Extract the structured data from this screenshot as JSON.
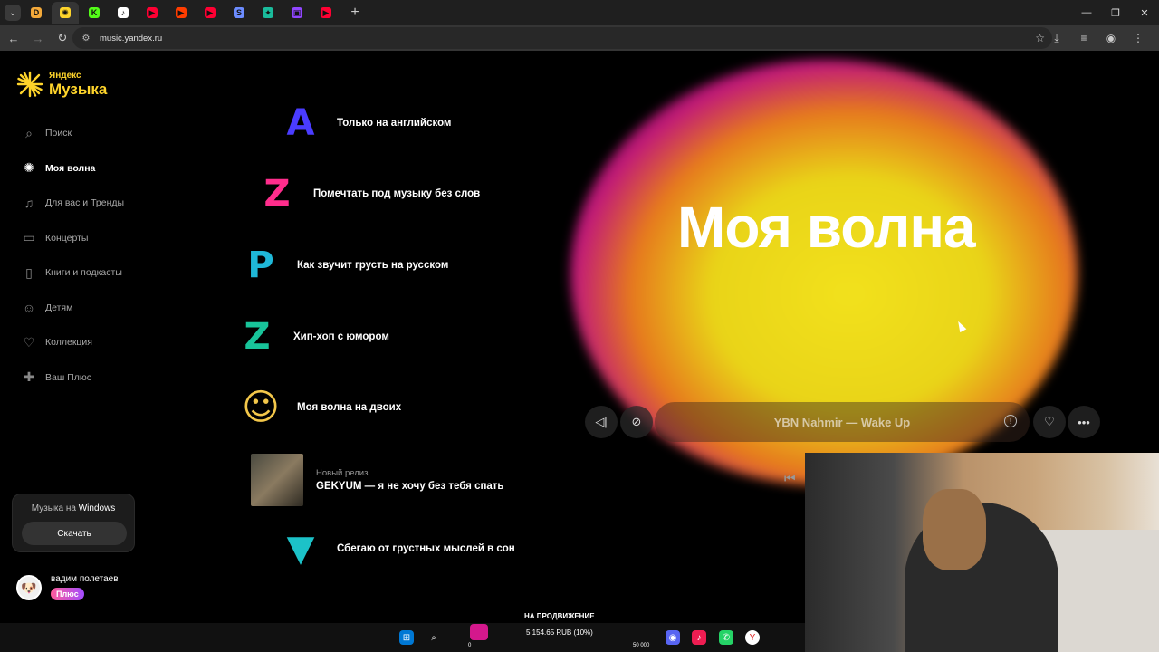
{
  "browser": {
    "tabs": [
      {
        "icon": "d-tab-icon",
        "color": "#f3a93a",
        "glyph": "D"
      },
      {
        "icon": "yandex-music-tab-icon",
        "color": "#fed42b",
        "glyph": "✺",
        "active": true
      },
      {
        "icon": "k-tab-icon",
        "color": "#53fc18",
        "glyph": "K"
      },
      {
        "icon": "tiktok-tab-icon",
        "color": "#ffffff",
        "glyph": "♪"
      },
      {
        "icon": "youtube-tab-icon",
        "color": "#ff0033",
        "glyph": "▶"
      },
      {
        "icon": "video-tab-icon",
        "color": "#ff3d00",
        "glyph": "▶"
      },
      {
        "icon": "youtube-tab-icon",
        "color": "#ff0033",
        "glyph": "▶"
      },
      {
        "icon": "s-tab-icon",
        "color": "#6c8cff",
        "glyph": "S"
      },
      {
        "icon": "figma-tab-icon",
        "color": "#1abc9c",
        "glyph": "✦"
      },
      {
        "icon": "twitch-tab-icon",
        "color": "#9146ff",
        "glyph": "▣"
      },
      {
        "icon": "youtube-tab-icon",
        "color": "#ff0033",
        "glyph": "▶"
      }
    ],
    "url": "music.yandex.ru"
  },
  "logo": {
    "small": "Яндекс",
    "big": "Музыка"
  },
  "nav": [
    {
      "label": "Поиск",
      "icon": "search-icon",
      "glyph": "⌕"
    },
    {
      "label": "Моя волна",
      "icon": "wave-icon",
      "glyph": "✺",
      "active": true
    },
    {
      "label": "Для вас и Тренды",
      "icon": "music-note-icon",
      "glyph": "♫"
    },
    {
      "label": "Концерты",
      "icon": "ticket-icon",
      "glyph": "▭"
    },
    {
      "label": "Книги и подкасты",
      "icon": "book-icon",
      "glyph": "▯"
    },
    {
      "label": "Детям",
      "icon": "kids-icon",
      "glyph": "☺"
    },
    {
      "label": "Коллекция",
      "icon": "heart-icon",
      "glyph": "♡"
    },
    {
      "label": "Ваш Плюс",
      "icon": "plus-icon",
      "glyph": "✚"
    }
  ],
  "download_card": {
    "title_prefix": "Музыка на",
    "title_os": "Windows",
    "button": "Скачать"
  },
  "user": {
    "name": "вадим полетаев",
    "badge": "Плюс"
  },
  "wave_settings": [
    {
      "title": "Только на английском",
      "glyph": "A",
      "color": "#4a3cff"
    },
    {
      "title": "Помечтать под музыку без слов",
      "glyph": "Z",
      "color": "#ff2d8c"
    },
    {
      "title": "Как звучит грусть на русском",
      "glyph": "P",
      "color": "#1fb8d8"
    },
    {
      "title": "Хип-хоп с юмором",
      "glyph": "Z",
      "color": "#18c49a"
    },
    {
      "title": "Моя волна на двоих",
      "glyph": "☺",
      "color": "#f3c74a"
    },
    {
      "title": "Сбегаю от грустных мыслей в сон",
      "glyph": "▼",
      "color": "#1cc2c8"
    }
  ],
  "release": {
    "label": "Новый релиз",
    "title": "GEKYUM — я не хочу без тебя спать"
  },
  "hero": {
    "title": "Моя волна"
  },
  "player": {
    "track": "YBN Nahmir — Wake Up"
  },
  "taskbar": {
    "promo": "НА ПРОДВИЖЕНИЕ",
    "amount": "5 154.65 RUB (10%)",
    "left_num": "0",
    "right_num": "50 000"
  }
}
